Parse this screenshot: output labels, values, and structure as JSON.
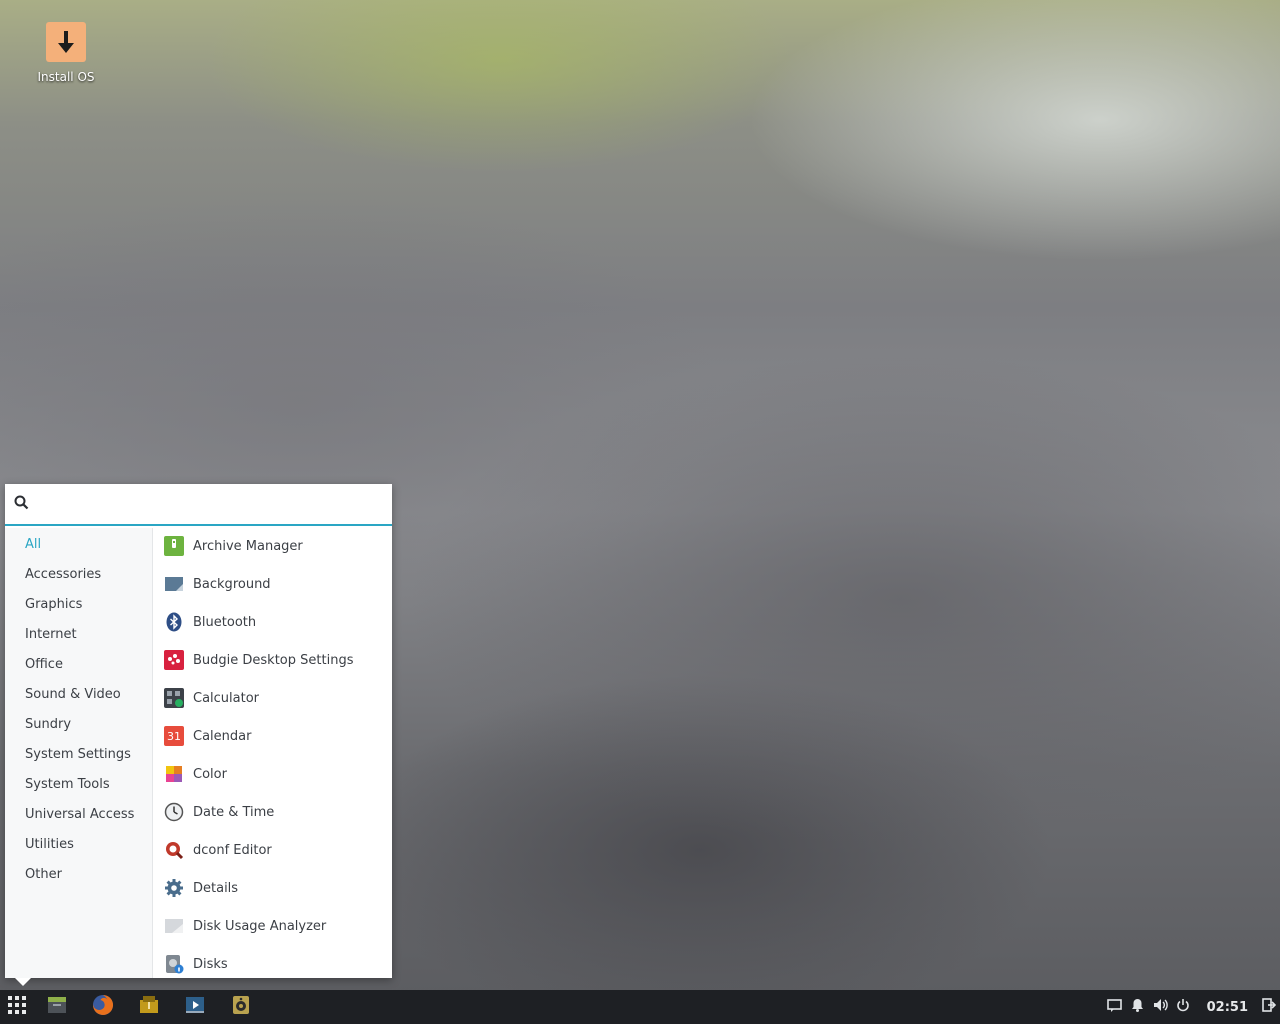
{
  "desktop": {
    "icons": [
      {
        "label": "Install OS",
        "icon": "download-icon"
      }
    ]
  },
  "menu": {
    "search": {
      "value": "",
      "placeholder": ""
    },
    "categories": [
      {
        "label": "All",
        "active": true
      },
      {
        "label": "Accessories"
      },
      {
        "label": "Graphics"
      },
      {
        "label": "Internet"
      },
      {
        "label": "Office"
      },
      {
        "label": "Sound & Video"
      },
      {
        "label": "Sundry"
      },
      {
        "label": "System Settings"
      },
      {
        "label": "System Tools"
      },
      {
        "label": "Universal Access"
      },
      {
        "label": "Utilities"
      },
      {
        "label": "Other"
      }
    ],
    "apps": [
      {
        "label": "Archive Manager",
        "icon": "archive-icon"
      },
      {
        "label": "Background",
        "icon": "background-icon"
      },
      {
        "label": "Bluetooth",
        "icon": "bluetooth-icon"
      },
      {
        "label": "Budgie Desktop Settings",
        "icon": "budgie-icon"
      },
      {
        "label": "Calculator",
        "icon": "calculator-icon"
      },
      {
        "label": "Calendar",
        "icon": "calendar-icon",
        "badge": "31"
      },
      {
        "label": "Color",
        "icon": "color-icon"
      },
      {
        "label": "Date & Time",
        "icon": "clock-icon"
      },
      {
        "label": "dconf Editor",
        "icon": "dconf-icon"
      },
      {
        "label": "Details",
        "icon": "gear-icon"
      },
      {
        "label": "Disk Usage Analyzer",
        "icon": "disk-usage-icon"
      },
      {
        "label": "Disks",
        "icon": "disks-icon"
      }
    ]
  },
  "taskbar": {
    "launchers": [
      "app-menu-icon",
      "file-manager-icon",
      "firefox-icon",
      "archive-icon",
      "video-player-icon",
      "speaker-icon"
    ],
    "tray": [
      "notifications-panel-icon",
      "bell-icon",
      "volume-icon",
      "power-icon"
    ],
    "clock": "02:51"
  },
  "colors": {
    "accent": "#2aa6c4",
    "panel": "#1e2024",
    "menu_bg": "#ffffff"
  }
}
